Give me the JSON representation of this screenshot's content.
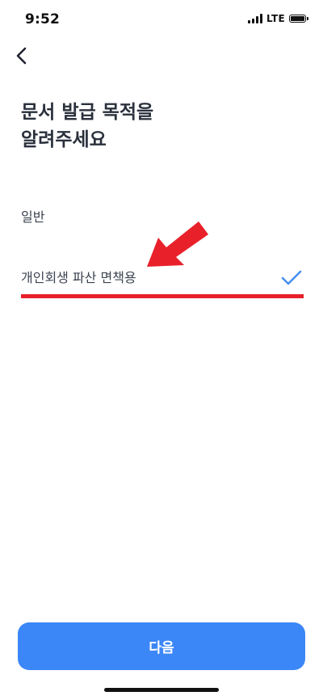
{
  "status_bar": {
    "time": "9:52",
    "network": "LTE",
    "icons": [
      "signal-bars-icon",
      "battery-icon"
    ]
  },
  "nav": {
    "back_icon": "chevron-left-icon"
  },
  "title": {
    "line1": "문서 발급 목적을",
    "line2": "알려주세요"
  },
  "options": [
    {
      "label": "일반",
      "selected": false
    },
    {
      "label": "개인회생 파산 면책용",
      "selected": true
    }
  ],
  "selected_check_icon": "checkmark-icon",
  "annotation": {
    "arrow_icon": "arrow-icon",
    "color": "#e8202a"
  },
  "colors": {
    "accent": "#3b87f7",
    "check": "#4a8ff0",
    "annotation": "#e8202a"
  },
  "footer": {
    "next_label": "다음"
  }
}
